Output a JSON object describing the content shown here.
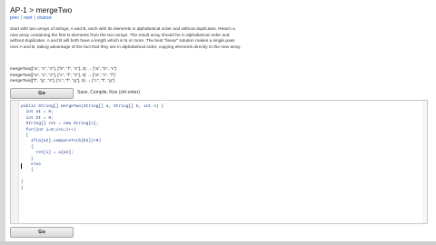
{
  "header": {
    "title": "AP-1 > mergeTwo",
    "nav": {
      "prev": "prev",
      "next": "next",
      "chance": "chance"
    }
  },
  "problem": {
    "description": "Start with two arrays of strings, A and B, each with its elements in alphabetical order and without duplicates. Return a new array containing the first N elements from the two arrays. The result array should be in alphabetical order and without duplicates. A and B will both have a length which is N or more. The best \"linear\" solution makes a single pass over A and B, taking advantage of the fact that they are in alphabetical order, copying elements directly to the new array.",
    "examples": [
      "mergeTwo([\"a\", \"c\", \"z\"], [\"b\", \"f\", \"z\"], 3) → [\"a\", \"b\", \"c\"]",
      "mergeTwo([\"a\", \"c\", \"z\"], [\"c\", \"f\", \"z\"], 3) → [\"a\", \"c\", \"f\"]",
      "mergeTwo([\"f\", \"g\", \"z\"], [\"c\", \"f\", \"g\"], 3) → [\"c\", \"f\", \"g\"]"
    ]
  },
  "controls": {
    "go_label": "Go",
    "hint": "Save, Compile, Run (ctrl-enter)",
    "go_bottom_label": "Go"
  },
  "editor": {
    "code": "public String[] mergeTwo(String[] a, String[] b, int n) {\n  int aI = 0;\n  int bI = 0;\n  String[] ret = new String[n];\n  for(int i=0;i<n;i++)\n  {\n    if(a[aI].compareTo(b[bI])<0)\n    {\n      ret[i] = a[aI];\n    }\n    else\n    {\n\n}\n}"
  }
}
